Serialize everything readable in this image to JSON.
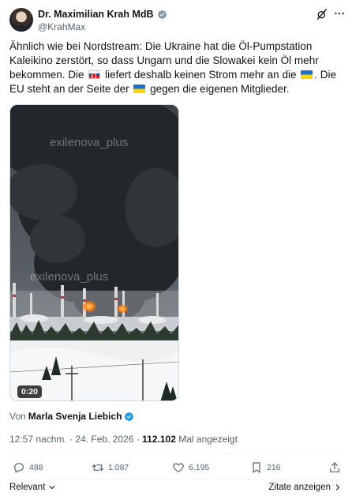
{
  "author": {
    "display_name": "Dr. Maximilian Krah MdB",
    "handle": "@KrahMax"
  },
  "tweet": {
    "text_1": "Ähnlich wie bei Nordstream: Die Ukraine hat die Öl-Pumpstation Kaleikino zerstört, so dass Ungarn und die Slowakei kein Öl mehr bekommen. Die",
    "flag_1": "Slovakia flag",
    "text_2": "liefert deshalb keinen Strom mehr an die",
    "flag_2": "Ukraine flag",
    "text_3": ". Die EU steht an der Seite der",
    "flag_3": "Ukraine flag",
    "text_4": "gegen die eigenen Mitglieder."
  },
  "media": {
    "watermark_1": "exilenova_plus",
    "watermark_2": "exilenova_plus",
    "duration": "0:20"
  },
  "attribution": {
    "prefix": "Von",
    "author": "Marla Svenja Liebich"
  },
  "meta": {
    "time": "12:57 nachm.",
    "separator": "·",
    "date": "24. Feb. 2026",
    "separator2": "·",
    "views_count": "112.102",
    "views_label": "Mal angezeigt"
  },
  "actions": {
    "replies": "488",
    "reposts": "1.087",
    "likes": "6.195",
    "bookmarks": "216"
  },
  "footer": {
    "left_label": "Relevant",
    "right_label": "Zitate anzeigen"
  },
  "colors": {
    "text": "#0f1419",
    "secondary": "#536471",
    "verified": "#1d9bf0"
  }
}
